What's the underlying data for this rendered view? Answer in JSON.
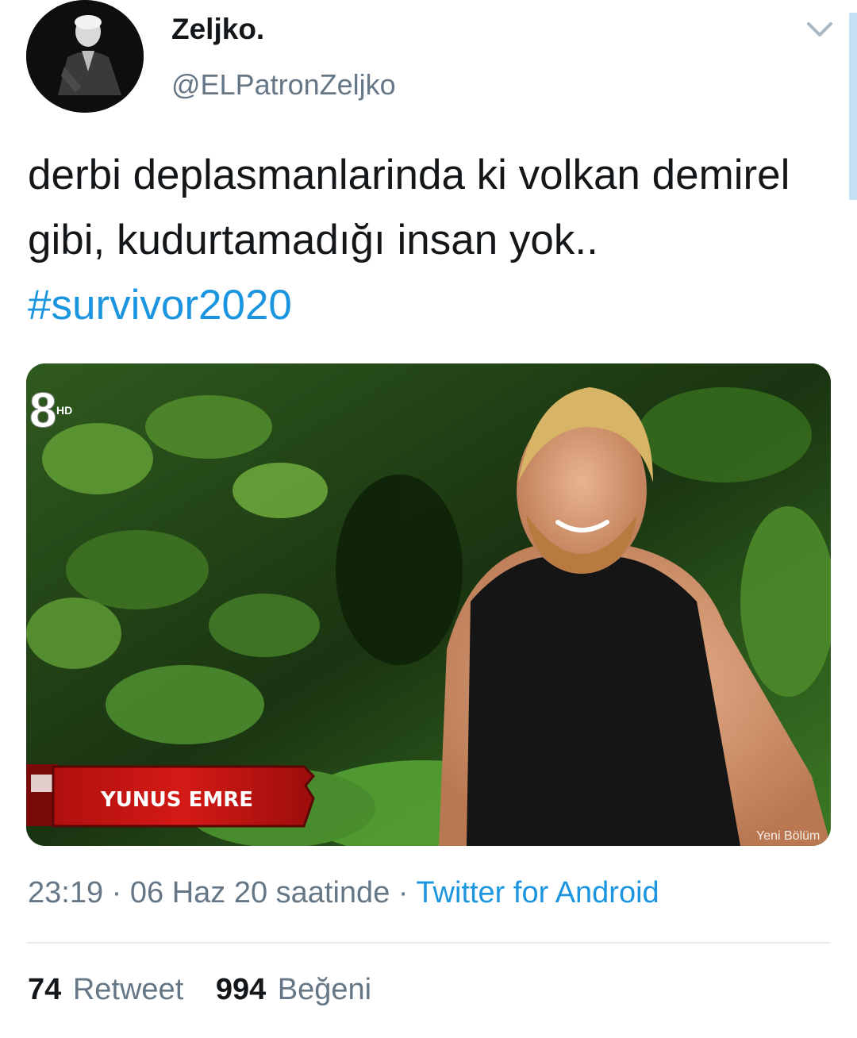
{
  "author": {
    "display_name": "Zeljko.",
    "handle": "@ELPatronZeljko",
    "avatar_icon": "user-avatar"
  },
  "menu": {
    "caret_icon": "chevron-down-icon"
  },
  "tweet": {
    "text_before": "derbi deplasmanlarinda ki volkan demirel gibi, kudurtamadığı insan yok.. ",
    "hashtag": "#survivor2020"
  },
  "media": {
    "channel_logo_text": "8",
    "channel_logo_hd": "HD",
    "lower_third_name": "YUNUS EMRE",
    "corner_text": "Yeni Bölüm"
  },
  "meta": {
    "time": "23:19",
    "date": "06 Haz 20 saatinde",
    "separator": "·",
    "source": "Twitter for Android"
  },
  "stats": {
    "retweets_count": "74",
    "retweets_label": "Retweet",
    "likes_count": "994",
    "likes_label": "Beğeni"
  },
  "colors": {
    "link": "#1b95e0",
    "secondary_text": "#657786",
    "primary_text": "#14171a",
    "divider": "#e6ecf0"
  }
}
